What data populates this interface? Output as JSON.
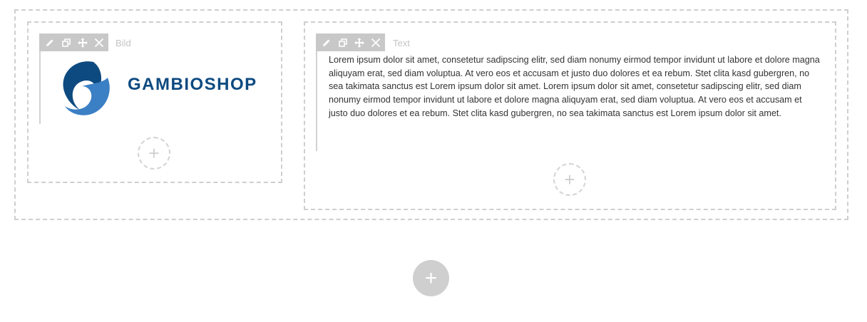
{
  "colors": {
    "dashed_border": "#cfcfcf",
    "toolbar_bg": "#c8c8c8",
    "brand_blue": "#0d4a80",
    "add_button_bg": "#cfcfcf"
  },
  "left_column": {
    "widget_label": "Bild",
    "toolbar_icons": [
      "edit-icon",
      "duplicate-icon",
      "move-icon",
      "delete-icon"
    ],
    "logo_text": "GAMBIOSHOP",
    "add_glyph": "+"
  },
  "right_column": {
    "widget_label": "Text",
    "toolbar_icons": [
      "edit-icon",
      "duplicate-icon",
      "move-icon",
      "delete-icon"
    ],
    "text_content": "Lorem ipsum dolor sit amet, consetetur sadipscing elitr, sed diam nonumy eirmod tempor invidunt ut labore et dolore magna aliquyam erat, sed diam voluptua. At vero eos et accusam et justo duo dolores et ea rebum. Stet clita kasd gubergren, no sea takimata sanctus est Lorem ipsum dolor sit amet. Lorem ipsum dolor sit amet, consetetur sadipscing elitr, sed diam nonumy eirmod tempor invidunt ut labore et dolore magna aliquyam erat, sed diam voluptua. At vero eos et accusam et justo duo dolores et ea rebum. Stet clita kasd gubergren, no sea takimata sanctus est Lorem ipsum dolor sit amet.",
    "add_glyph": "+"
  },
  "add_row_glyph": "+"
}
